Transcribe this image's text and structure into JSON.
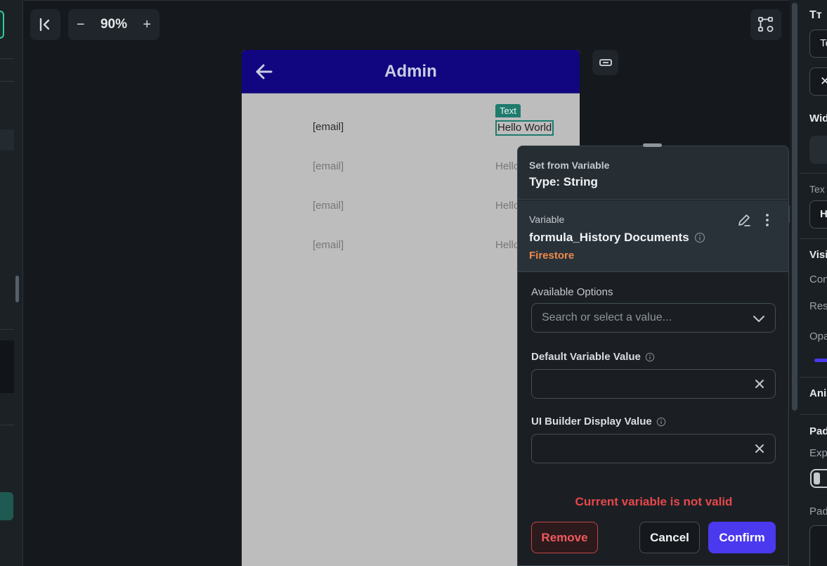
{
  "toolbar": {
    "zoom_minus": "−",
    "zoom_value": "90%",
    "zoom_plus": "+"
  },
  "phone": {
    "title": "Admin",
    "selected_tag": "Text",
    "rows": [
      {
        "email": "[email]",
        "hello": "Hello World"
      },
      {
        "email": "[email]",
        "hello": "Hello"
      },
      {
        "email": "[email]",
        "hello": "Hello"
      },
      {
        "email": "[email]",
        "hello": "Hello"
      }
    ]
  },
  "popup": {
    "header_label": "Set from Variable",
    "type_label": "Type: String",
    "variable_label": "Variable",
    "variable_name": "formula_History Documents",
    "variable_source": "Firestore",
    "available_options_label": "Available Options",
    "search_placeholder": "Search or select a value...",
    "default_value_label": "Default Variable Value",
    "default_value": "",
    "display_value_label": "UI Builder Display Value",
    "display_value": "",
    "error": "Current variable is not valid",
    "remove_label": "Remove",
    "cancel_label": "Cancel",
    "confirm_label": "Confirm"
  },
  "right_panel": {
    "tt_label": "Tт",
    "input1": "Te",
    "wid_label": "Wid",
    "tex_label": "Tex",
    "h_value": "H",
    "visi_label": "Visi",
    "con_label": "Con",
    "res_label": "Res",
    "opa_label": "Opa",
    "ani_label": "Ani",
    "pad_label": "Pad",
    "exp_label": "Exp",
    "pad2_label": "Pad"
  },
  "colors": {
    "accent": "#4b39ef",
    "header_bg": "#11067f",
    "teal": "#1e7b6e",
    "error": "#e5484d",
    "firestore": "#ee8a4b"
  }
}
